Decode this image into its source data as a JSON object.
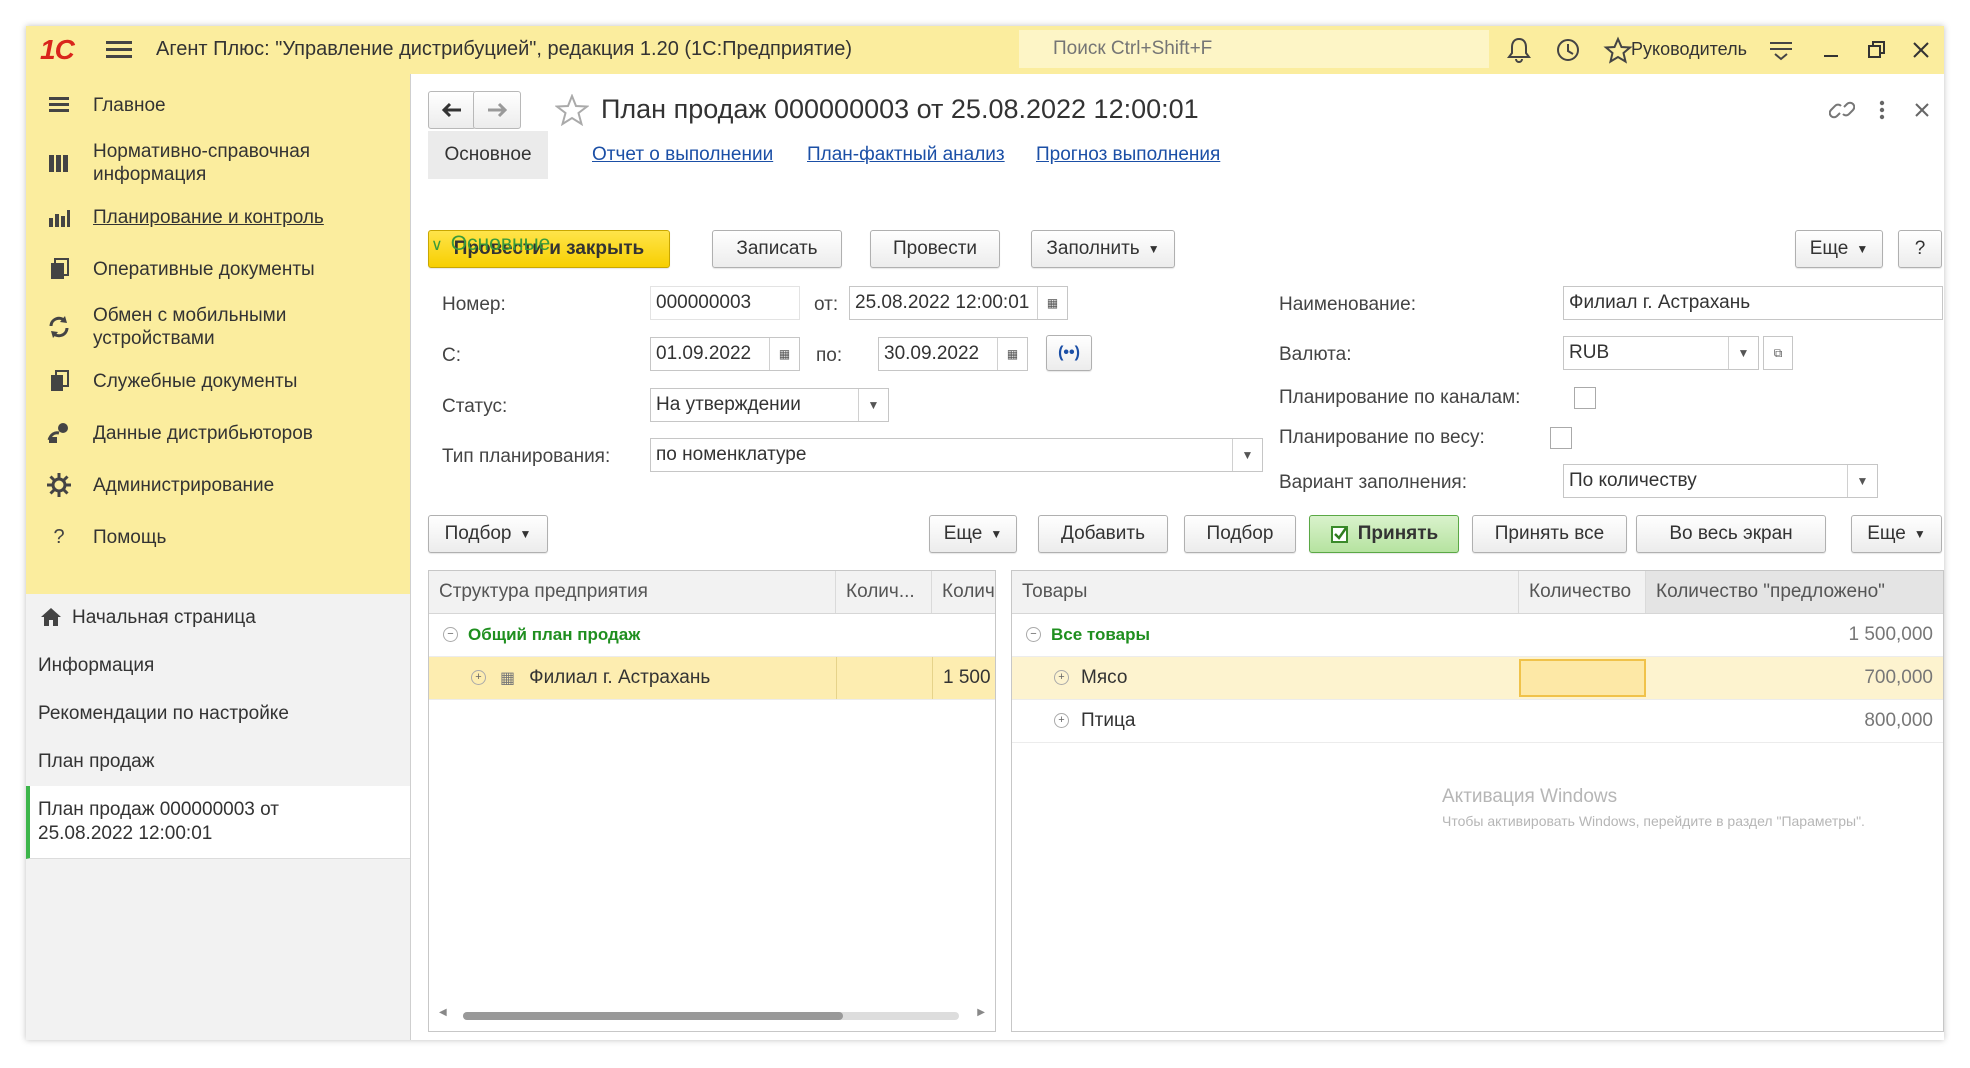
{
  "app": {
    "logo": "1С",
    "title": "Агент Плюс: \"Управление дистрибуцией\", редакция 1.20  (1С:Предприятие)",
    "search_placeholder": "Поиск Ctrl+Shift+F",
    "user": "Руководитель"
  },
  "sidebar": {
    "items": [
      {
        "label": "Главное",
        "icon": "menu-icon"
      },
      {
        "label": "Нормативно-справочная информация",
        "icon": "catalog-icon"
      },
      {
        "label": "Планирование и контроль",
        "icon": "chart-icon"
      },
      {
        "label": "Оперативные документы",
        "icon": "documents-icon"
      },
      {
        "label": "Обмен с мобильными устройствами",
        "icon": "sync-icon"
      },
      {
        "label": "Служебные документы",
        "icon": "service-docs-icon"
      },
      {
        "label": "Данные дистрибьюторов",
        "icon": "distributors-icon"
      },
      {
        "label": "Администрирование",
        "icon": "gear-icon"
      },
      {
        "label": "Помощь",
        "icon": "help-icon"
      }
    ],
    "open_windows": [
      {
        "label": "Начальная страница"
      },
      {
        "label": "Информация"
      },
      {
        "label": "Рекомендации по настройке"
      },
      {
        "label": "План продаж"
      },
      {
        "label": "План продаж 000000003 от 25.08.2022 12:00:01"
      }
    ]
  },
  "document": {
    "title": "План продаж 000000003 от 25.08.2022 12:00:01",
    "tabs": [
      "Основное",
      "Отчет о выполнении",
      "План-фактный анализ",
      "Прогноз выполнения"
    ],
    "toolbar": {
      "post_close": "Провести и закрыть",
      "save": "Записать",
      "post": "Провести",
      "fill": "Заполнить",
      "more": "Еще",
      "help": "?"
    },
    "section": "Основные",
    "form": {
      "number_label": "Номер:",
      "number": "000000003",
      "from_label": "от:",
      "date": "25.08.2022 12:00:01",
      "start_label": "С:",
      "start": "01.09.2022",
      "end_label": "по:",
      "end": "30.09.2022",
      "status_label": "Статус:",
      "status": "На утверждении",
      "plan_type_label": "Тип планирования:",
      "plan_type": "по номенклатуре",
      "name_label": "Наименование:",
      "name": "Филиал г. Астрахань",
      "currency_label": "Валюта:",
      "currency": "RUB",
      "by_channels_label": "Планирование по каналам:",
      "by_weight_label": "Планирование по весу:",
      "fill_variant_label": "Вариант заполнения:",
      "fill_variant": "По количеству"
    },
    "left_toolbar": {
      "pick": "Подбор",
      "more": "Еще"
    },
    "right_toolbar": {
      "add": "Добавить",
      "pick": "Подбор",
      "accept": "Принять",
      "accept_all": "Принять все",
      "fullscreen": "Во весь экран",
      "more": "Еще"
    },
    "left_table": {
      "headers": [
        "Структура предприятия",
        "Колич...",
        "Колич"
      ],
      "group": "Общий план продаж",
      "rows": [
        {
          "name": "Филиал г. Астрахань",
          "qty": "",
          "qty2": "1 500"
        }
      ]
    },
    "right_table": {
      "headers": [
        "Товары",
        "Количество",
        "Количество \"предложено\""
      ],
      "group": {
        "name": "Все товары",
        "proposed": "1 500,000"
      },
      "rows": [
        {
          "name": "Мясо",
          "qty": "",
          "proposed": "700,000"
        },
        {
          "name": "Птица",
          "qty": "",
          "proposed": "800,000"
        }
      ]
    },
    "watermark": {
      "title": "Активация Windows",
      "text": "Чтобы активировать Windows, перейдите в раздел \"Параметры\"."
    }
  },
  "colors": {
    "titlebar": "#fbed9e",
    "accent_yellow": "#f7cf00",
    "link": "#1b4fa6",
    "group_green": "#1f8f1f",
    "selected_row": "#fdedb0"
  }
}
